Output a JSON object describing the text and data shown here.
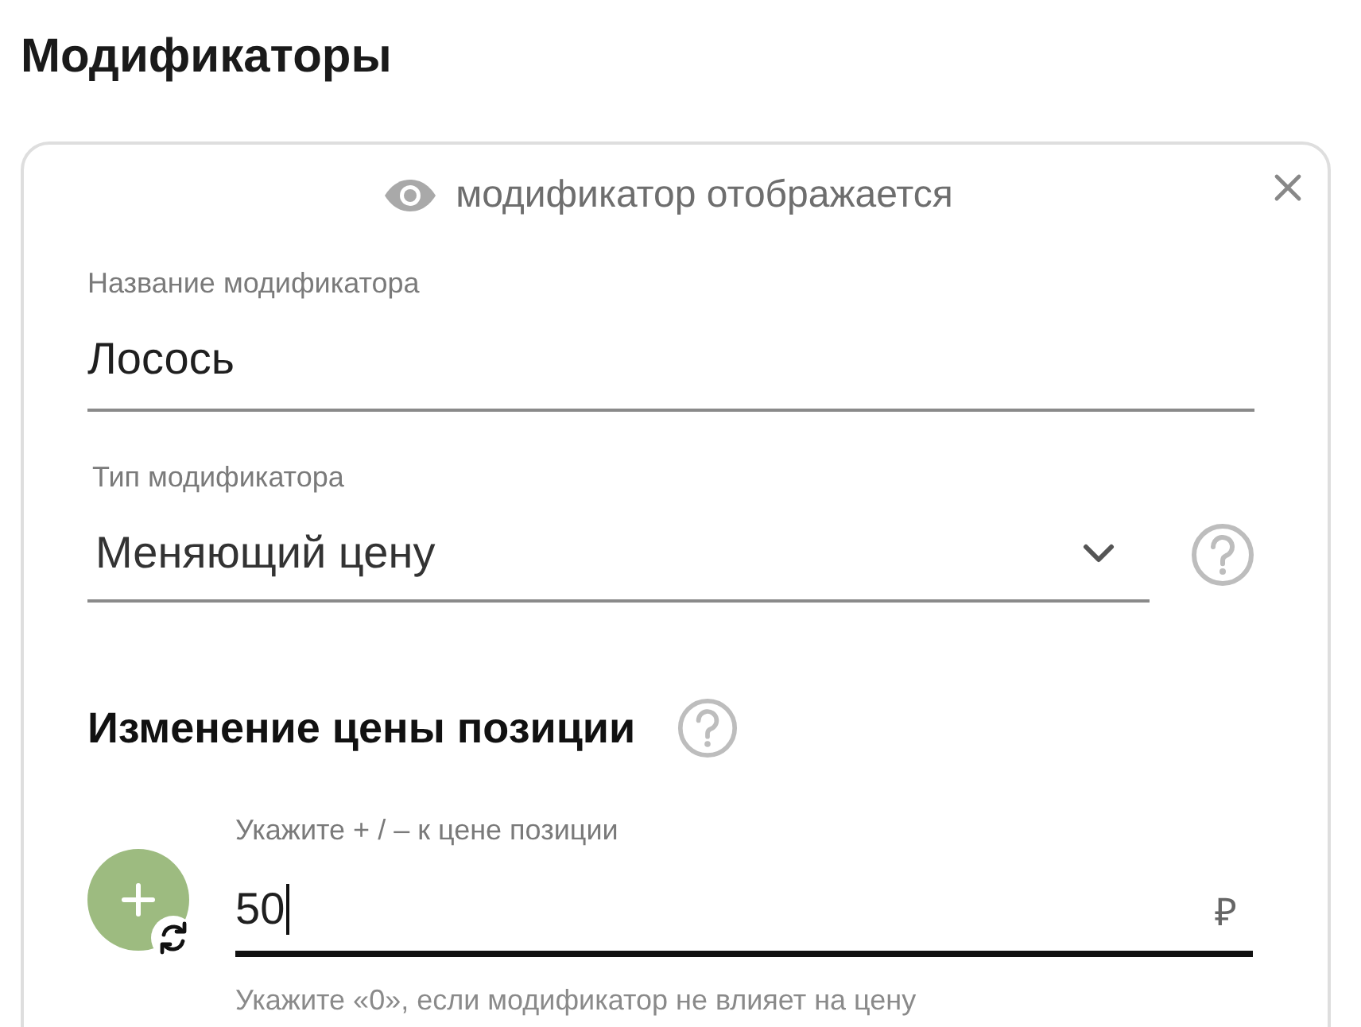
{
  "page": {
    "title": "Модификаторы"
  },
  "modifier": {
    "visible": true,
    "visibility_label": "модификатор отображается",
    "name_field": {
      "label": "Название модификатора",
      "value": "Лосось"
    },
    "type_select": {
      "label": "Тип модификатора",
      "value": "Меняющий цену"
    },
    "price_section": {
      "heading": "Изменение цены позиции",
      "field": {
        "label": "Укажите + / – к цене позиции",
        "value": "50",
        "currency": "₽",
        "focused": true
      },
      "hint": "Укажите «0», если модификатор не влияет на цену"
    }
  }
}
